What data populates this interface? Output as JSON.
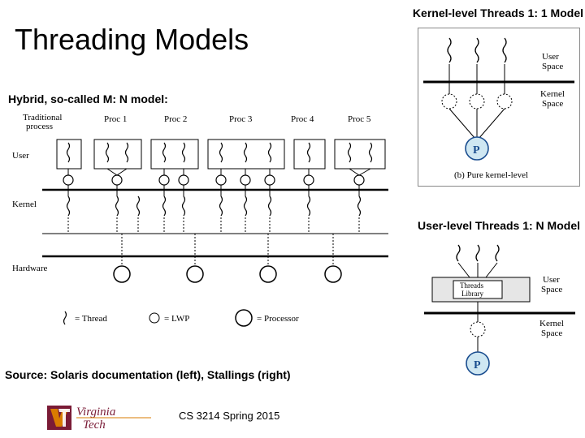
{
  "title": "Threading Models",
  "header_kernel": "Kernel-level Threads 1: 1 Model",
  "subtitle": "Hybrid, so-called M: N model:",
  "header_user": "User-level Threads 1: N Model",
  "source_note": "Source: Solaris documentation (left), Stallings (right)",
  "footer_course": "CS 3214 Spring 2015",
  "mn": {
    "traditional": "Traditional",
    "process": "process",
    "procs": [
      "Proc 1",
      "Proc 2",
      "Proc 3",
      "Proc 4",
      "Proc 5"
    ],
    "row_user": "User",
    "row_kernel": "Kernel",
    "row_hardware": "Hardware",
    "legend_thread": "= Thread",
    "legend_lwp": "= LWP",
    "legend_proc": "= Processor"
  },
  "kernel_level": {
    "user_space": "User\nSpace",
    "kernel_space": "Kernel\nSpace",
    "p": "P",
    "caption": "(b) Pure kernel-level"
  },
  "user_level": {
    "threads_lib": "Threads\nLibrary",
    "user_space": "User\nSpace",
    "kernel_space": "Kernel\nSpace",
    "p": "P"
  },
  "vt": {
    "name1": "Virginia",
    "name2": "Tech"
  }
}
